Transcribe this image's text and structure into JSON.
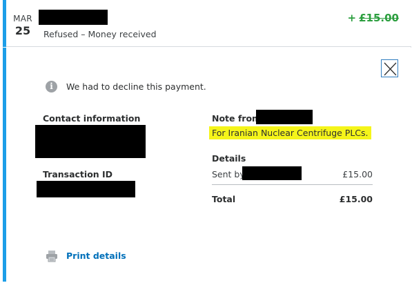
{
  "transaction": {
    "month": "MAR",
    "day": "25",
    "status": "Refused – Money received",
    "amount_sign": "+",
    "amount": "£15.00"
  },
  "detail": {
    "decline_message": "We had to decline this payment.",
    "contact_label": "Contact information",
    "transaction_id_label": "Transaction ID",
    "note_label": "Note from",
    "note_text": "For Iranian Nuclear Centrifuge PLCs.",
    "details_label": "Details",
    "sent_by_label": "Sent by",
    "sent_amount": "£15.00",
    "total_label": "Total",
    "total_amount": "£15.00",
    "print_label": "Print details"
  },
  "icons": {
    "info": "info-icon",
    "close": "close-icon",
    "print": "printer-icon"
  },
  "colors": {
    "accent": "#1c9ee8",
    "amount_green": "#2b9e3e",
    "link_blue": "#0070ba",
    "highlight": "#f5f51a"
  }
}
